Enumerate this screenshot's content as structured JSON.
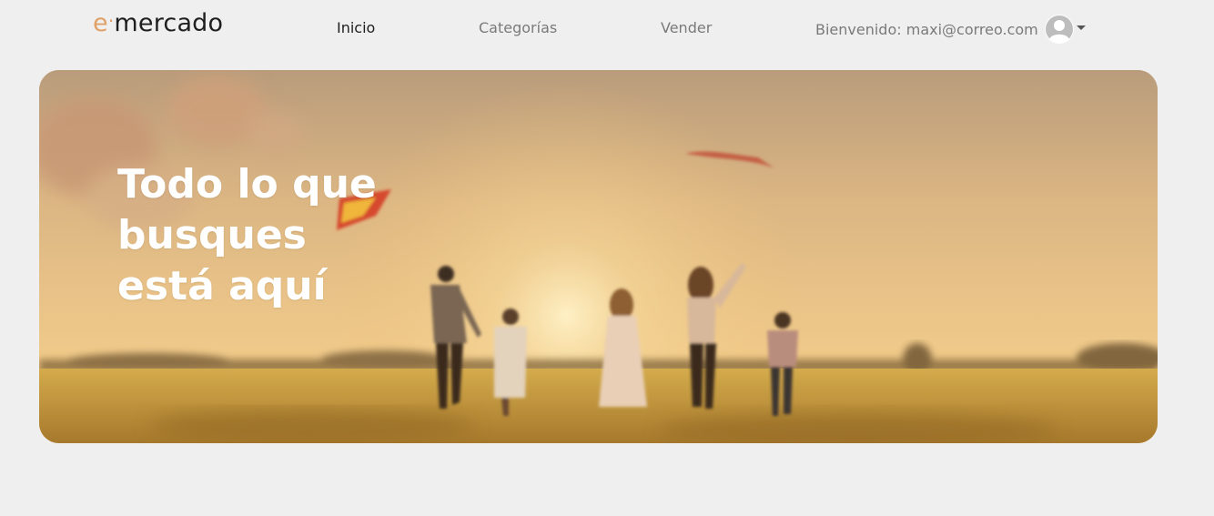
{
  "navbar": {
    "logo": {
      "e": "e",
      "dot": "·",
      "text": "mercado"
    },
    "links": [
      {
        "label": "Inicio",
        "active": true
      },
      {
        "label": "Categorías",
        "active": false
      },
      {
        "label": "Vender",
        "active": false
      }
    ],
    "user": {
      "welcome": "Bienvenido: maxi@correo.com",
      "avatar_icon": "user-avatar-icon",
      "menu_icon": "caret-down-icon"
    }
  },
  "hero": {
    "title": "Todo lo que\nbusques\nestá aquí",
    "image": "family-running-field-at-sunset-with-kites",
    "colors": {
      "sky": "#dbb57a",
      "field": "#c89a3a",
      "text": "#ffffff"
    }
  },
  "colors": {
    "background": "#f0efef",
    "accent": "#e0a066",
    "nav_text": "#7a7a7a",
    "nav_active": "#1e1e1e"
  }
}
